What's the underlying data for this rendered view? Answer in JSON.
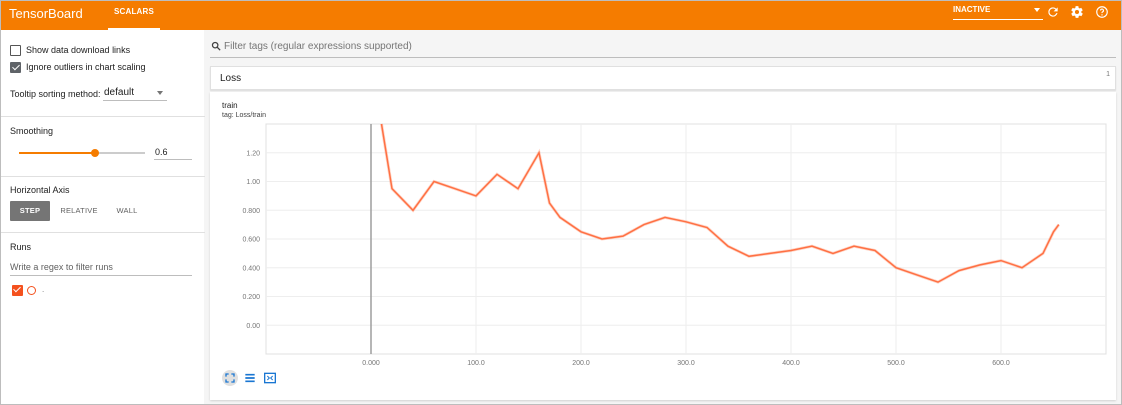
{
  "app": {
    "title": "TensorBoard",
    "tab": "SCALARS",
    "status": "INACTIVE",
    "icons": [
      "refresh-icon",
      "settings-icon",
      "help-icon"
    ],
    "brand_color": "#f57c00"
  },
  "sidebar": {
    "show_download_label": "Show data download links",
    "show_download_checked": false,
    "ignore_outliers_label": "Ignore outliers in chart scaling",
    "ignore_outliers_checked": true,
    "tooltip_label": "Tooltip sorting method:",
    "tooltip_value": "default",
    "smoothing_label": "Smoothing",
    "smoothing_value": "0.6",
    "smoothing_fraction": 0.6,
    "horizontal_axis_label": "Horizontal Axis",
    "axis_options": [
      "STEP",
      "RELATIVE",
      "WALL"
    ],
    "axis_selected": "STEP",
    "runs_label": "Runs",
    "runs_placeholder": "Write a regex to filter runs",
    "run_name": "."
  },
  "main": {
    "filter_placeholder": "Filter tags (regular expressions supported)",
    "group_title": "Loss",
    "group_count": "1",
    "card_title": "train",
    "card_tag": "tag: Loss/train"
  },
  "chart_data": {
    "type": "line",
    "series_color": "#ff7043",
    "ylim": [
      -0.2,
      1.4
    ],
    "xlim": [
      -100,
      700
    ],
    "yticks": [
      "0.00",
      "0.200",
      "0.400",
      "0.600",
      "0.800",
      "1.00",
      "1.20"
    ],
    "xticks": [
      "0.000",
      "100.0",
      "200.0",
      "300.0",
      "400.0",
      "500.0",
      "600.0"
    ],
    "series": [
      {
        "x": [
          10,
          20,
          40,
          60,
          80,
          100,
          120,
          140,
          160,
          170,
          180,
          200,
          220,
          240,
          260,
          280,
          300,
          320,
          340,
          360,
          380,
          400,
          420,
          440,
          460,
          480,
          500,
          520,
          540,
          560,
          580,
          600,
          620,
          640,
          650,
          655
        ],
        "y": [
          1.4,
          0.95,
          0.8,
          1.0,
          0.95,
          0.9,
          1.05,
          0.95,
          1.2,
          0.85,
          0.75,
          0.65,
          0.6,
          0.62,
          0.7,
          0.75,
          0.72,
          0.68,
          0.55,
          0.48,
          0.5,
          0.52,
          0.55,
          0.5,
          0.55,
          0.52,
          0.4,
          0.35,
          0.3,
          0.38,
          0.42,
          0.45,
          0.4,
          0.5,
          0.65,
          0.7
        ]
      }
    ]
  }
}
